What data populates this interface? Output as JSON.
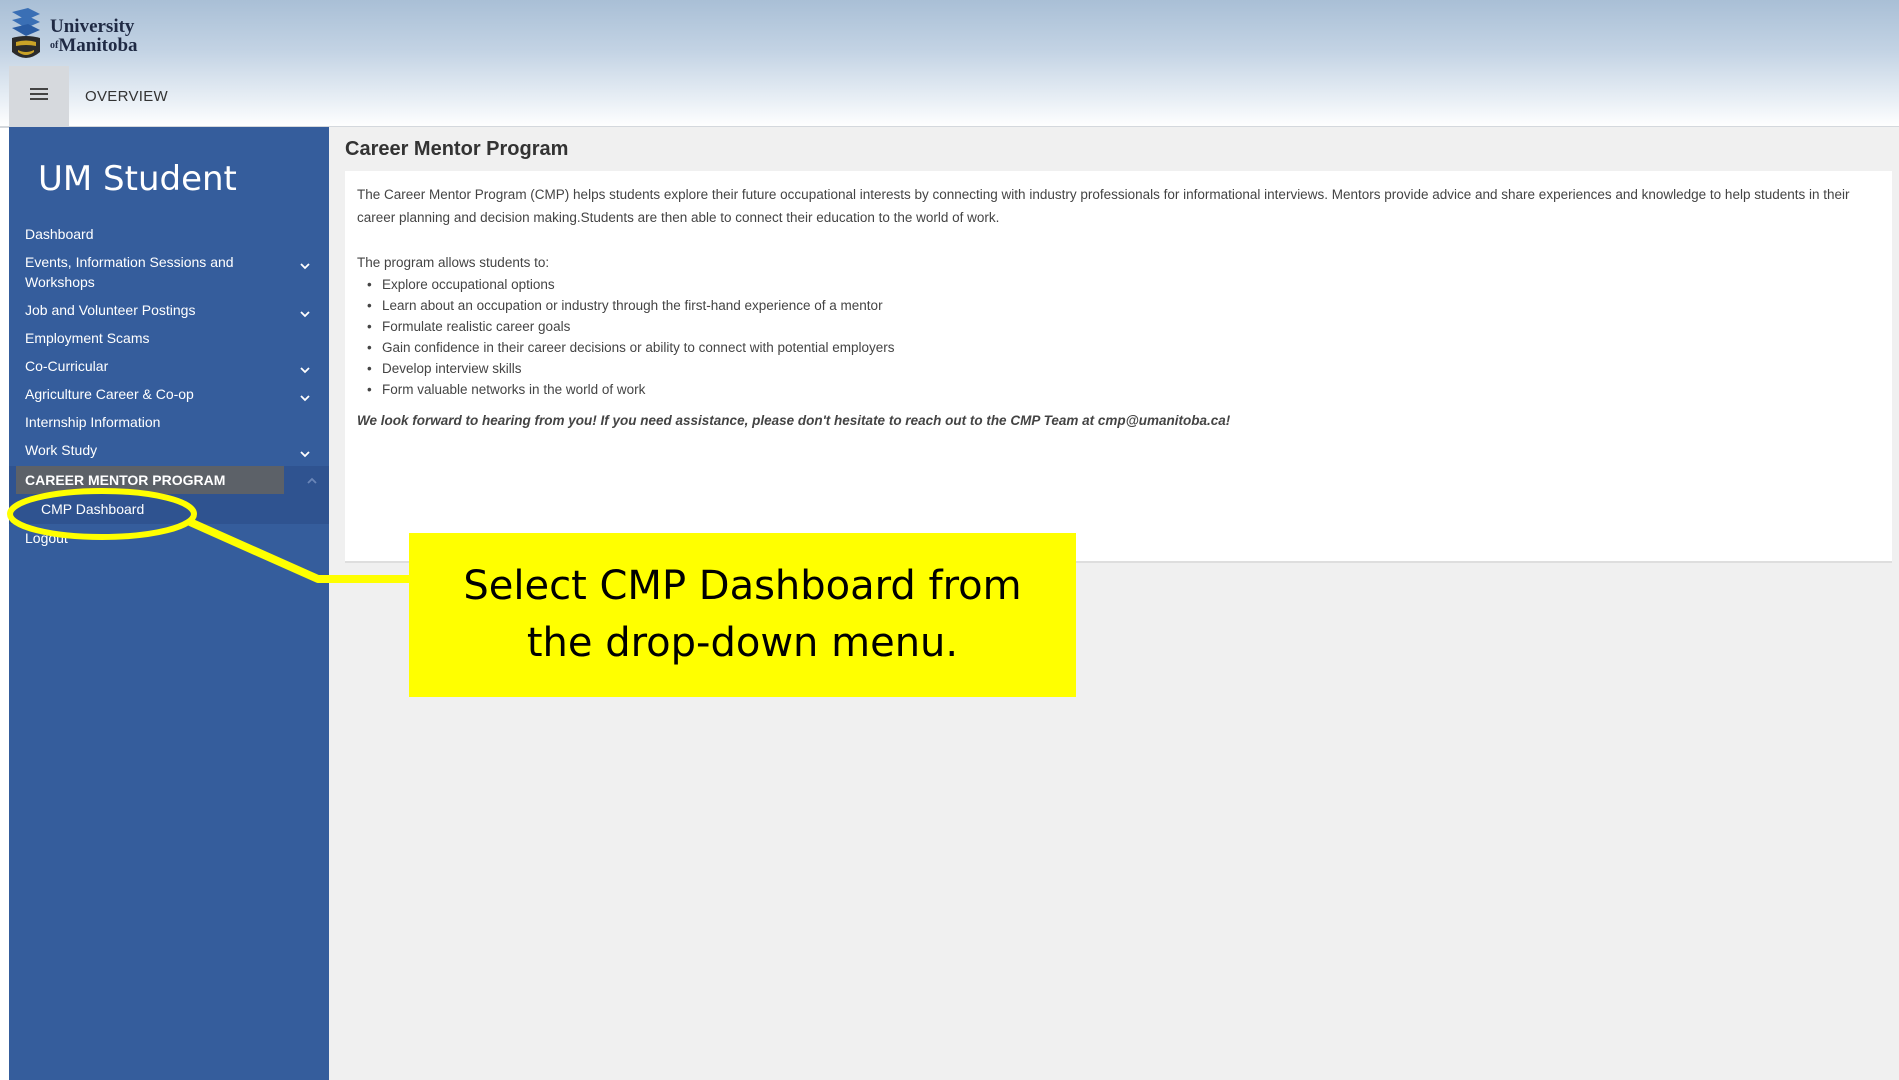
{
  "brand": {
    "logo_line1": "University",
    "logo_prefix": "of",
    "logo_line2": "Manitoba"
  },
  "topbar": {
    "breadcrumb": "OVERVIEW"
  },
  "sidebar": {
    "title": "UM Student",
    "items": [
      {
        "label": "Dashboard",
        "has_chevron": false
      },
      {
        "label": "Events, Information Sessions and Workshops",
        "has_chevron": true
      },
      {
        "label": "Job and Volunteer Postings",
        "has_chevron": true
      },
      {
        "label": "Employment Scams",
        "has_chevron": false
      },
      {
        "label": "Co-Curricular",
        "has_chevron": true
      },
      {
        "label": "Agriculture Career & Co-op",
        "has_chevron": true
      },
      {
        "label": "Internship Information",
        "has_chevron": false
      },
      {
        "label": "Work Study",
        "has_chevron": true
      }
    ],
    "active_group": {
      "label": "CAREER MENTOR PROGRAM",
      "sub_item": "CMP Dashboard"
    },
    "logout": "Logout"
  },
  "main": {
    "title": "Career Mentor Program",
    "intro": "The Career Mentor Program (CMP) helps students explore their future occupational interests by connecting with industry professionals for informational interviews. Mentors provide advice and share experiences and knowledge to help students in their career planning and decision making.Students are then able to connect their education to the world of work.",
    "list_title": "The program allows students to:",
    "bullets": [
      "Explore occupational options",
      "Learn about an occupation or industry through the first-hand experience of a mentor",
      "Formulate realistic career goals",
      "Gain confidence in their career decisions or ability to connect with potential employers",
      "Develop interview skills",
      "Form valuable networks in the world of work"
    ],
    "closing": "We look forward to hearing from you! If you need assistance, please don't hesitate to reach out to the CMP Team at cmp@umanitoba.ca!"
  },
  "annotation": {
    "line1": "Select CMP Dashboard from",
    "line2": "the drop-down menu.",
    "highlight_color": "#ffff00"
  },
  "colors": {
    "sidebar_bg": "#355d9c",
    "active_group_bg": "#5c6168",
    "main_bg": "#f0f0f0"
  },
  "icons": {
    "menu": "hamburger-icon",
    "expand": "chevron-down-icon",
    "collapse": "chevron-up-icon"
  }
}
